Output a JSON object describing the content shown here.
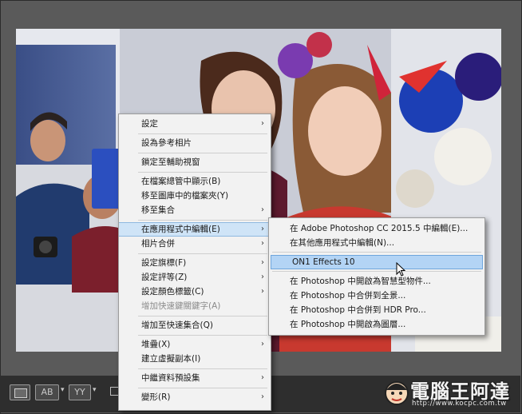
{
  "main_menu": {
    "items": [
      {
        "label": "設定",
        "submenu": true
      },
      {
        "label": "設為參考相片"
      },
      {
        "label": "鎖定至輔助視窗"
      },
      {
        "label": "在檔案總管中顯示(B)"
      },
      {
        "label": "移至圖庫中的檔案夾(Y)"
      },
      {
        "label": "移至集合",
        "submenu": true
      },
      {
        "label": "在應用程式中編輯(E)",
        "submenu": true,
        "highlighted": true
      },
      {
        "label": "相片合併",
        "submenu": true
      },
      {
        "label": "設定旗標(F)",
        "submenu": true
      },
      {
        "label": "設定評等(Z)",
        "submenu": true
      },
      {
        "label": "設定顏色標籤(C)",
        "submenu": true
      },
      {
        "label": "增加快速鍵關鍵字(A)",
        "disabled": true
      },
      {
        "label": "增加至快速集合(Q)"
      },
      {
        "label": "堆疊(X)",
        "submenu": true
      },
      {
        "label": "建立虛擬副本(I)"
      },
      {
        "label": "中繼資料預設集",
        "submenu": true
      },
      {
        "label": "變形(R)",
        "submenu": true
      }
    ],
    "arrow_glyph": "›"
  },
  "sub_menu": {
    "items": [
      {
        "label": "在 Adobe Photoshop CC 2015.5 中編輯(E)..."
      },
      {
        "label": "在其他應用程式中編輯(N)..."
      },
      {
        "label": "ON1 Effects 10",
        "highlighted": true
      },
      {
        "label": "在 Photoshop 中開啟為智慧型物件..."
      },
      {
        "label": "在 Photoshop 中合併到全景..."
      },
      {
        "label": "在 Photoshop 中合併到 HDR Pro..."
      },
      {
        "label": "在 Photoshop 中開啟為圖層..."
      }
    ]
  },
  "toolbar": {
    "ab_label": "AB",
    "yy_label": "YY",
    "caret": "▾"
  },
  "watermark": {
    "title": "電腦王阿達",
    "url": "http://www.kocpc.com.tw"
  },
  "colors": {
    "menu_bg": "#f2f2f2",
    "highlight": "#cfe4f7",
    "highlight_sub": "#b3d4f5",
    "frame": "#595959"
  }
}
